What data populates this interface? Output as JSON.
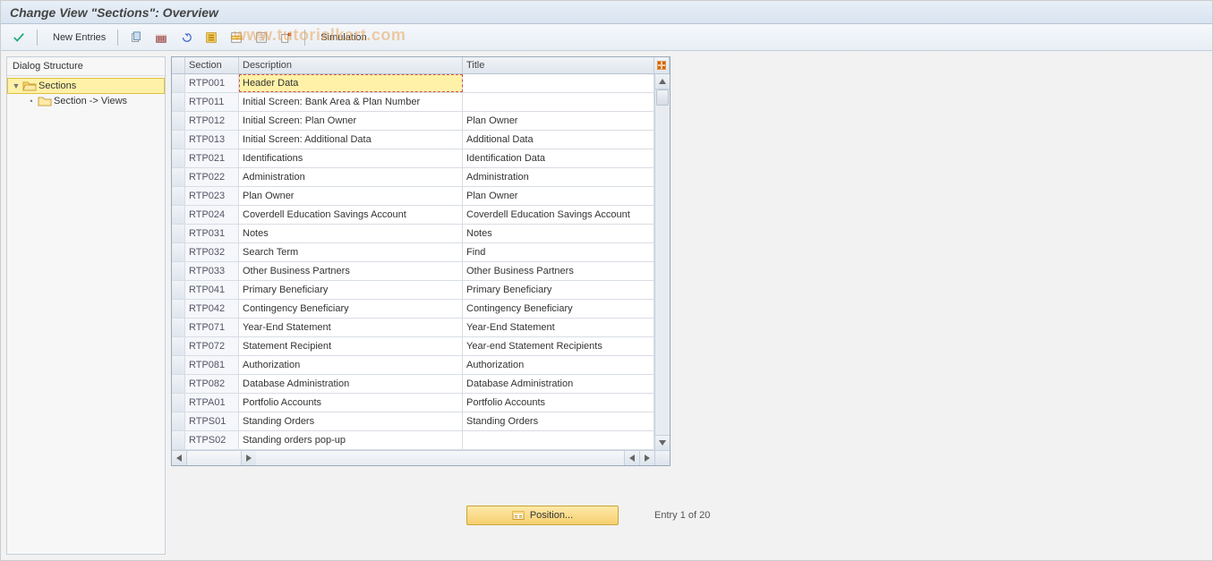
{
  "window": {
    "title": "Change View \"Sections\": Overview"
  },
  "toolbar": {
    "check_tooltip": "Check",
    "new_entries_label": "New Entries",
    "copy_tooltip": "Copy As",
    "delete_tooltip": "Delete",
    "undo_tooltip": "Undo Change",
    "select_all_tooltip": "Select All",
    "select_block_tooltip": "Select Block",
    "deselect_all_tooltip": "Deselect All",
    "config_tooltip": "Table Settings",
    "simulation_label": "Simulation"
  },
  "watermark": "www.tutorialkart.com",
  "sidebar": {
    "title": "Dialog Structure",
    "items": [
      {
        "label": "Sections",
        "open": true,
        "selected": true
      },
      {
        "label": "Section -> Views",
        "open": false,
        "selected": false
      }
    ]
  },
  "table": {
    "columns": {
      "section": "Section",
      "description": "Description",
      "title": "Title"
    },
    "rows": [
      {
        "section": "RTP001",
        "description": "Header Data",
        "title": "",
        "active": true
      },
      {
        "section": "RTP011",
        "description": "Initial Screen: Bank Area & Plan Number",
        "title": ""
      },
      {
        "section": "RTP012",
        "description": "Initial Screen: Plan Owner",
        "title": "Plan Owner"
      },
      {
        "section": "RTP013",
        "description": "Initial Screen: Additional Data",
        "title": "Additional Data"
      },
      {
        "section": "RTP021",
        "description": "Identifications",
        "title": "Identification Data"
      },
      {
        "section": "RTP022",
        "description": "Administration",
        "title": "Administration"
      },
      {
        "section": "RTP023",
        "description": "Plan Owner",
        "title": "Plan Owner"
      },
      {
        "section": "RTP024",
        "description": "Coverdell Education Savings Account",
        "title": "Coverdell Education Savings Account"
      },
      {
        "section": "RTP031",
        "description": "Notes",
        "title": "Notes"
      },
      {
        "section": "RTP032",
        "description": "Search Term",
        "title": "Find"
      },
      {
        "section": "RTP033",
        "description": "Other Business Partners",
        "title": "Other Business Partners"
      },
      {
        "section": "RTP041",
        "description": "Primary Beneficiary",
        "title": "Primary Beneficiary"
      },
      {
        "section": "RTP042",
        "description": "Contingency Beneficiary",
        "title": "Contingency Beneficiary"
      },
      {
        "section": "RTP071",
        "description": "Year-End Statement",
        "title": "Year-End Statement"
      },
      {
        "section": "RTP072",
        "description": "Statement Recipient",
        "title": "Year-end Statement Recipients"
      },
      {
        "section": "RTP081",
        "description": "Authorization",
        "title": "Authorization"
      },
      {
        "section": "RTP082",
        "description": "Database Administration",
        "title": "Database Administration"
      },
      {
        "section": "RTPA01",
        "description": "Portfolio Accounts",
        "title": "Portfolio Accounts"
      },
      {
        "section": "RTPS01",
        "description": "Standing Orders",
        "title": "Standing Orders"
      },
      {
        "section": "RTPS02",
        "description": "Standing orders pop-up",
        "title": ""
      }
    ]
  },
  "footer": {
    "position_label": "Position...",
    "entry_info": "Entry 1 of 20"
  },
  "icons": {
    "check": "check-icon",
    "copy": "copy-icon",
    "delete": "delete-icon",
    "undo": "undo-icon",
    "select_all": "select-all-icon",
    "select_block": "select-block-icon",
    "deselect_all": "deselect-all-icon",
    "config": "configuration-icon",
    "folder_open": "folder-open-icon",
    "folder_closed": "folder-closed-icon",
    "table_settings": "table-settings-icon"
  }
}
